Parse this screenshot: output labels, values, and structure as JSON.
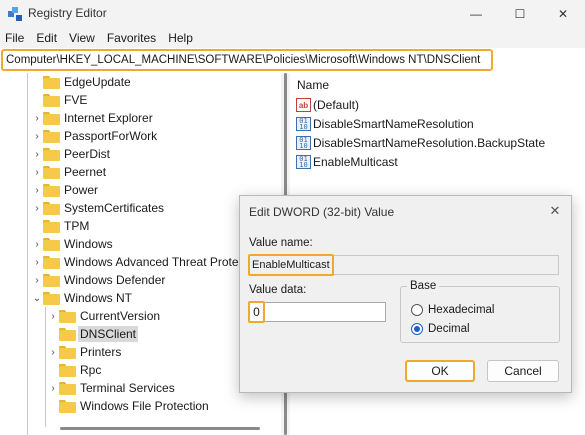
{
  "window": {
    "title": "Registry Editor",
    "minimize": "—",
    "maximize": "☐",
    "close": "✕"
  },
  "menu": [
    "File",
    "Edit",
    "View",
    "Favorites",
    "Help"
  ],
  "address": "Computer\\HKEY_LOCAL_MACHINE\\SOFTWARE\\Policies\\Microsoft\\Windows NT\\DNSClient",
  "tree": [
    {
      "label": "EdgeUpdate",
      "chevron": ""
    },
    {
      "label": "FVE",
      "chevron": ""
    },
    {
      "label": "Internet Explorer",
      "chevron": "›"
    },
    {
      "label": "PassportForWork",
      "chevron": "›"
    },
    {
      "label": "PeerDist",
      "chevron": "›"
    },
    {
      "label": "Peernet",
      "chevron": "›"
    },
    {
      "label": "Power",
      "chevron": "›"
    },
    {
      "label": "SystemCertificates",
      "chevron": "›"
    },
    {
      "label": "TPM",
      "chevron": ""
    },
    {
      "label": "Windows",
      "chevron": "›"
    },
    {
      "label": "Windows Advanced Threat Protec",
      "chevron": "›"
    },
    {
      "label": "Windows Defender",
      "chevron": "›"
    },
    {
      "label": "Windows NT",
      "chevron": "⌄"
    },
    {
      "label": "CurrentVersion",
      "chevron": "›"
    },
    {
      "label": "DNSClient",
      "chevron": ""
    },
    {
      "label": "Printers",
      "chevron": "›"
    },
    {
      "label": "Rpc",
      "chevron": ""
    },
    {
      "label": "Terminal Services",
      "chevron": "›"
    },
    {
      "label": "Windows File Protection",
      "chevron": ""
    }
  ],
  "values": {
    "column_name": "Name",
    "items": [
      {
        "name": "(Default)",
        "type": "string"
      },
      {
        "name": "DisableSmartNameResolution",
        "type": "binary"
      },
      {
        "name": "DisableSmartNameResolution.BackupState",
        "type": "binary"
      },
      {
        "name": "EnableMulticast",
        "type": "binary"
      }
    ]
  },
  "dialog": {
    "title": "Edit DWORD (32-bit) Value",
    "close": "✕",
    "value_name_label": "Value name:",
    "value_name": "EnableMulticast",
    "value_data_label": "Value data:",
    "value_data": "0",
    "base_label": "Base",
    "base_options": [
      {
        "label": "Hexadecimal",
        "selected": false
      },
      {
        "label": "Decimal",
        "selected": true
      }
    ],
    "ok": "OK",
    "cancel": "Cancel"
  },
  "colors": {
    "highlight": "#f0a830",
    "folder": "#f7c948",
    "radio_selected": "#1f5fbf"
  }
}
